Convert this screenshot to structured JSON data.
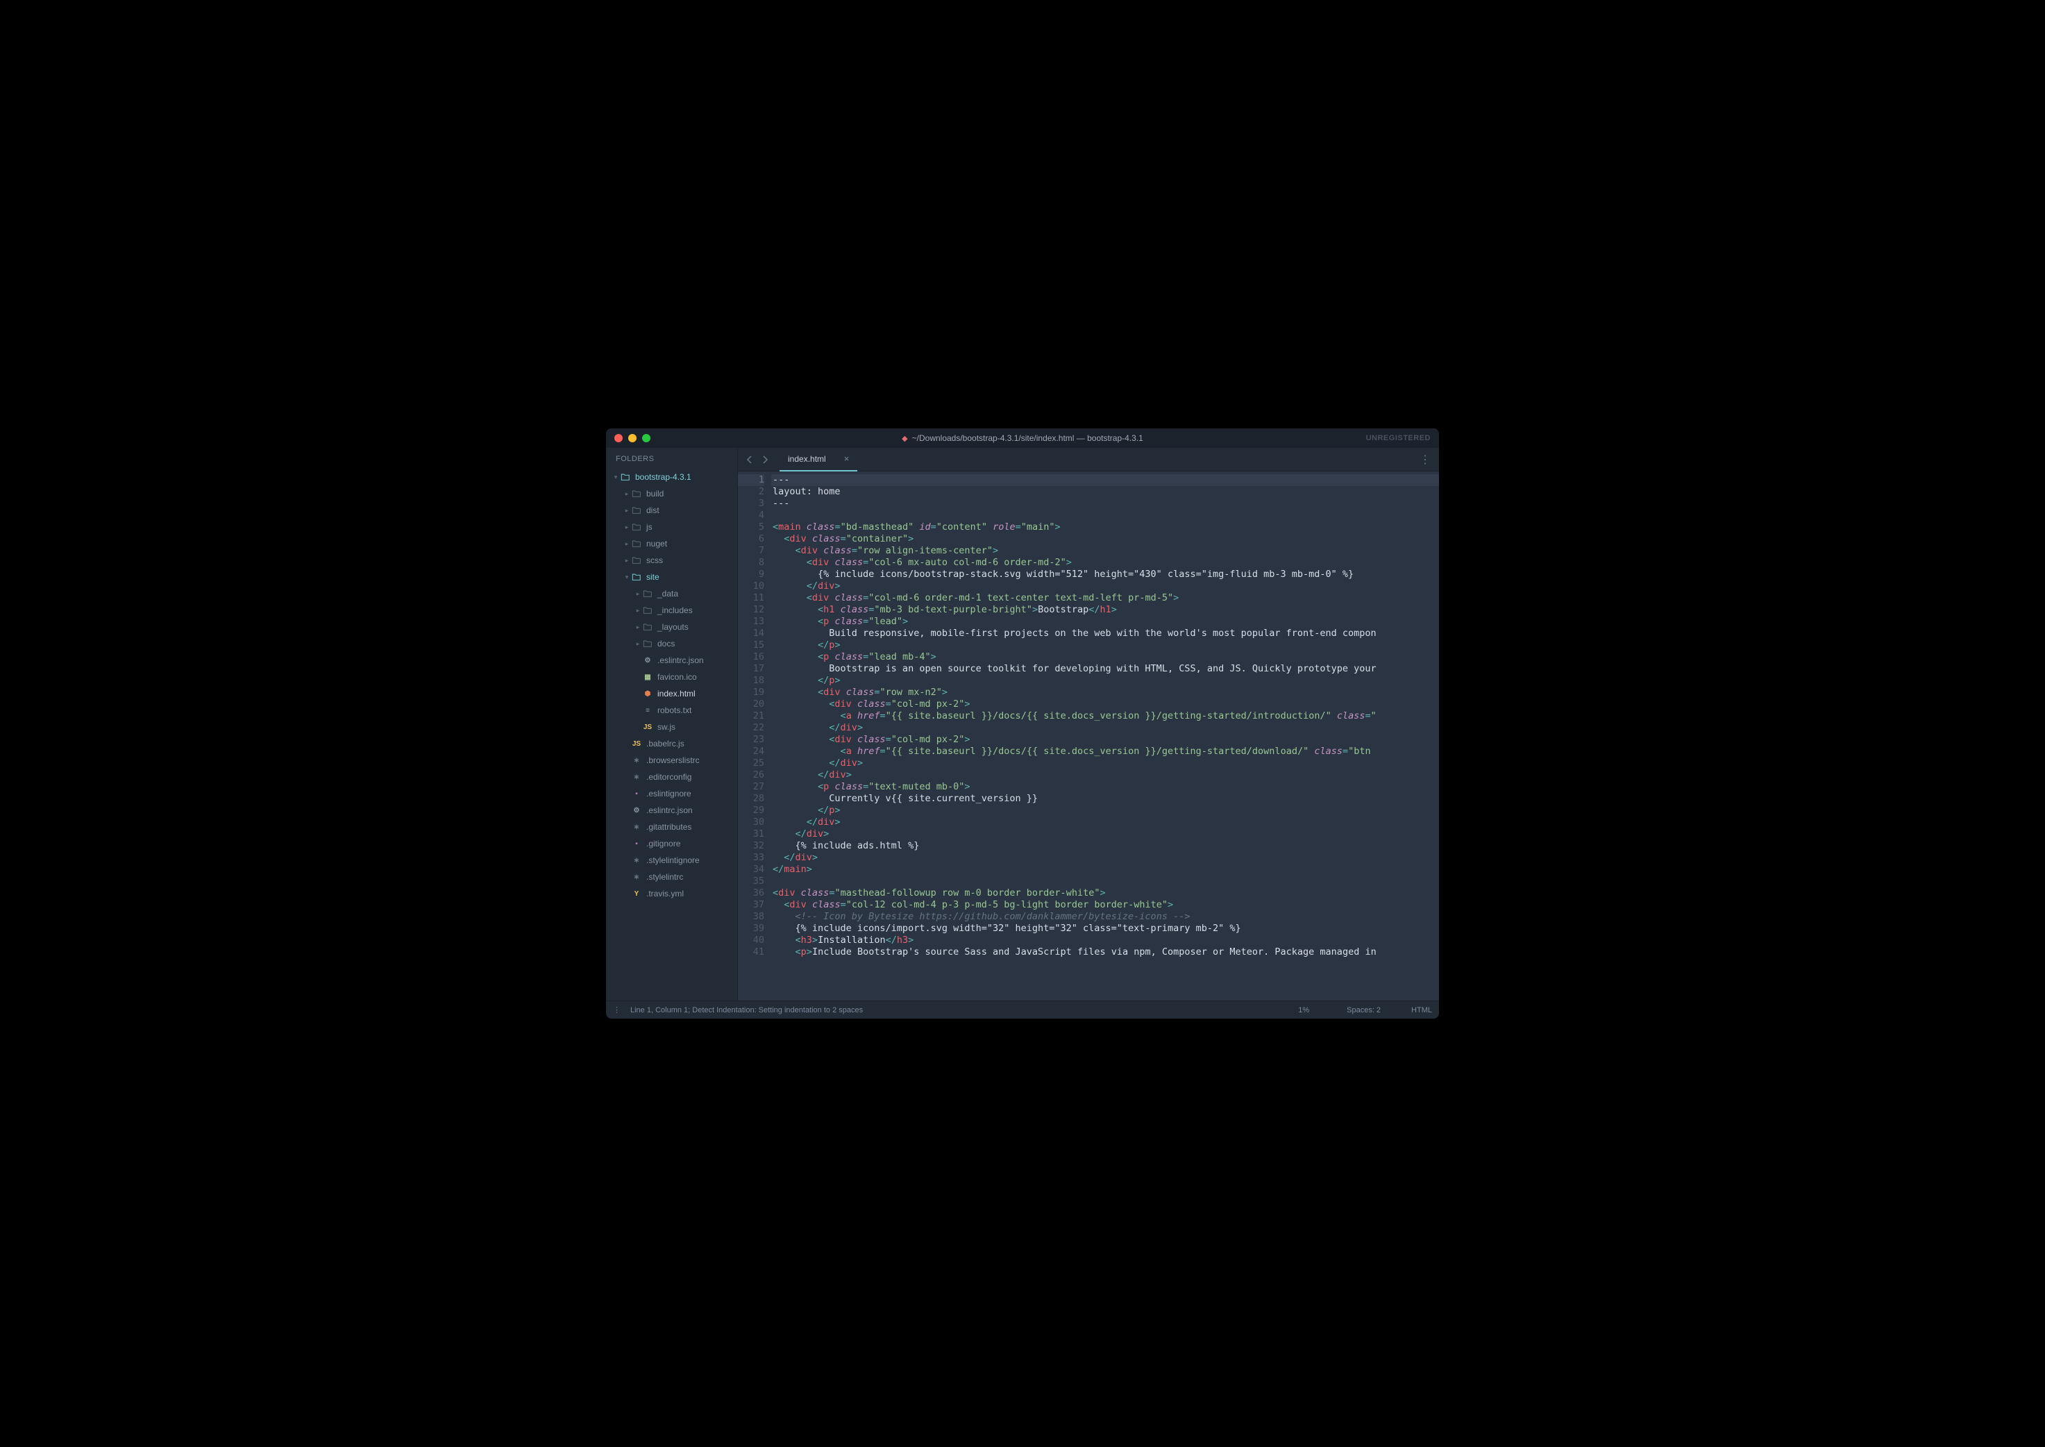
{
  "titlebar": {
    "path": "~/Downloads/bootstrap-4.3.1/site/index.html — bootstrap-4.3.1",
    "unregistered": "UNREGISTERED"
  },
  "sidebar": {
    "header": "FOLDERS",
    "tree": [
      {
        "label": "bootstrap-4.3.1",
        "kind": "folder-open",
        "depth": 0
      },
      {
        "label": "build",
        "kind": "folder",
        "depth": 1
      },
      {
        "label": "dist",
        "kind": "folder",
        "depth": 1
      },
      {
        "label": "js",
        "kind": "folder",
        "depth": 1
      },
      {
        "label": "nuget",
        "kind": "folder",
        "depth": 1
      },
      {
        "label": "scss",
        "kind": "folder",
        "depth": 1
      },
      {
        "label": "site",
        "kind": "folder-open",
        "depth": 1
      },
      {
        "label": "_data",
        "kind": "folder",
        "depth": 2
      },
      {
        "label": "_includes",
        "kind": "folder",
        "depth": 2
      },
      {
        "label": "_layouts",
        "kind": "folder",
        "depth": 2
      },
      {
        "label": "docs",
        "kind": "folder",
        "depth": 2
      },
      {
        "label": ".eslintrc.json",
        "kind": "file",
        "depth": 2,
        "icon": "gear"
      },
      {
        "label": "favicon.ico",
        "kind": "file",
        "depth": 2,
        "icon": "image"
      },
      {
        "label": "index.html",
        "kind": "file",
        "depth": 2,
        "icon": "html",
        "active": true
      },
      {
        "label": "robots.txt",
        "kind": "file",
        "depth": 2,
        "icon": "text"
      },
      {
        "label": "sw.js",
        "kind": "file",
        "depth": 2,
        "icon": "js"
      },
      {
        "label": ".babelrc.js",
        "kind": "file",
        "depth": 1,
        "icon": "js"
      },
      {
        "label": ".browserslistrc",
        "kind": "file",
        "depth": 1,
        "icon": "generic"
      },
      {
        "label": ".editorconfig",
        "kind": "file",
        "depth": 1,
        "icon": "generic"
      },
      {
        "label": ".eslintignore",
        "kind": "file",
        "depth": 1,
        "icon": "ignore"
      },
      {
        "label": ".eslintrc.json",
        "kind": "file",
        "depth": 1,
        "icon": "gear"
      },
      {
        "label": ".gitattributes",
        "kind": "file",
        "depth": 1,
        "icon": "generic"
      },
      {
        "label": ".gitignore",
        "kind": "file",
        "depth": 1,
        "icon": "ignore"
      },
      {
        "label": ".stylelintignore",
        "kind": "file",
        "depth": 1,
        "icon": "generic"
      },
      {
        "label": ".stylelintrc",
        "kind": "file",
        "depth": 1,
        "icon": "generic"
      },
      {
        "label": ".travis.yml",
        "kind": "file",
        "depth": 1,
        "icon": "yaml"
      }
    ]
  },
  "tab": {
    "label": "index.html"
  },
  "code_lines": [
    [
      [
        "pl",
        "---"
      ]
    ],
    [
      [
        "pl",
        "layout: home"
      ]
    ],
    [
      [
        "pl",
        "---"
      ]
    ],
    [],
    [
      [
        "p",
        "<"
      ],
      [
        "t",
        "main"
      ],
      [
        "pl",
        " "
      ],
      [
        "a it",
        "class"
      ],
      [
        "p",
        "="
      ],
      [
        "s",
        "\"bd-masthead\""
      ],
      [
        "pl",
        " "
      ],
      [
        "a it",
        "id"
      ],
      [
        "p",
        "="
      ],
      [
        "s",
        "\"content\""
      ],
      [
        "pl",
        " "
      ],
      [
        "a it",
        "role"
      ],
      [
        "p",
        "="
      ],
      [
        "s",
        "\"main\""
      ],
      [
        "p",
        ">"
      ]
    ],
    [
      [
        "pl",
        "  "
      ],
      [
        "p",
        "<"
      ],
      [
        "t",
        "div"
      ],
      [
        "pl",
        " "
      ],
      [
        "a it",
        "class"
      ],
      [
        "p",
        "="
      ],
      [
        "s",
        "\"container\""
      ],
      [
        "p",
        ">"
      ]
    ],
    [
      [
        "pl",
        "    "
      ],
      [
        "p",
        "<"
      ],
      [
        "t",
        "div"
      ],
      [
        "pl",
        " "
      ],
      [
        "a it",
        "class"
      ],
      [
        "p",
        "="
      ],
      [
        "s",
        "\"row align-items-center\""
      ],
      [
        "p",
        ">"
      ]
    ],
    [
      [
        "pl",
        "      "
      ],
      [
        "p",
        "<"
      ],
      [
        "t",
        "div"
      ],
      [
        "pl",
        " "
      ],
      [
        "a it",
        "class"
      ],
      [
        "p",
        "="
      ],
      [
        "s",
        "\"col-6 mx-auto col-md-6 order-md-2\""
      ],
      [
        "p",
        ">"
      ]
    ],
    [
      [
        "pl",
        "        {% include icons/bootstrap-stack.svg width=\"512\" height=\"430\" class=\"img-fluid mb-3 mb-md-0\" %}"
      ]
    ],
    [
      [
        "pl",
        "      "
      ],
      [
        "p",
        "</"
      ],
      [
        "t",
        "div"
      ],
      [
        "p",
        ">"
      ]
    ],
    [
      [
        "pl",
        "      "
      ],
      [
        "p",
        "<"
      ],
      [
        "t",
        "div"
      ],
      [
        "pl",
        " "
      ],
      [
        "a it",
        "class"
      ],
      [
        "p",
        "="
      ],
      [
        "s",
        "\"col-md-6 order-md-1 text-center text-md-left pr-md-5\""
      ],
      [
        "p",
        ">"
      ]
    ],
    [
      [
        "pl",
        "        "
      ],
      [
        "p",
        "<"
      ],
      [
        "t",
        "h1"
      ],
      [
        "pl",
        " "
      ],
      [
        "a it",
        "class"
      ],
      [
        "p",
        "="
      ],
      [
        "s",
        "\"mb-3 bd-text-purple-bright\""
      ],
      [
        "p",
        ">"
      ],
      [
        "pl",
        "Bootstrap"
      ],
      [
        "p",
        "</"
      ],
      [
        "t",
        "h1"
      ],
      [
        "p",
        ">"
      ]
    ],
    [
      [
        "pl",
        "        "
      ],
      [
        "p",
        "<"
      ],
      [
        "t",
        "p"
      ],
      [
        "pl",
        " "
      ],
      [
        "a it",
        "class"
      ],
      [
        "p",
        "="
      ],
      [
        "s",
        "\"lead\""
      ],
      [
        "p",
        ">"
      ]
    ],
    [
      [
        "pl",
        "          Build responsive, mobile-first projects on the web with the world's most popular front-end compon"
      ]
    ],
    [
      [
        "pl",
        "        "
      ],
      [
        "p",
        "</"
      ],
      [
        "t",
        "p"
      ],
      [
        "p",
        ">"
      ]
    ],
    [
      [
        "pl",
        "        "
      ],
      [
        "p",
        "<"
      ],
      [
        "t",
        "p"
      ],
      [
        "pl",
        " "
      ],
      [
        "a it",
        "class"
      ],
      [
        "p",
        "="
      ],
      [
        "s",
        "\"lead mb-4\""
      ],
      [
        "p",
        ">"
      ]
    ],
    [
      [
        "pl",
        "          Bootstrap is an open source toolkit for developing with HTML, CSS, and JS. Quickly prototype your"
      ]
    ],
    [
      [
        "pl",
        "        "
      ],
      [
        "p",
        "</"
      ],
      [
        "t",
        "p"
      ],
      [
        "p",
        ">"
      ]
    ],
    [
      [
        "pl",
        "        "
      ],
      [
        "p",
        "<"
      ],
      [
        "t",
        "div"
      ],
      [
        "pl",
        " "
      ],
      [
        "a it",
        "class"
      ],
      [
        "p",
        "="
      ],
      [
        "s",
        "\"row mx-n2\""
      ],
      [
        "p",
        ">"
      ]
    ],
    [
      [
        "pl",
        "          "
      ],
      [
        "p",
        "<"
      ],
      [
        "t",
        "div"
      ],
      [
        "pl",
        " "
      ],
      [
        "a it",
        "class"
      ],
      [
        "p",
        "="
      ],
      [
        "s",
        "\"col-md px-2\""
      ],
      [
        "p",
        ">"
      ]
    ],
    [
      [
        "pl",
        "            "
      ],
      [
        "p",
        "<"
      ],
      [
        "t",
        "a"
      ],
      [
        "pl",
        " "
      ],
      [
        "a it",
        "href"
      ],
      [
        "p",
        "="
      ],
      [
        "s",
        "\"{{ site.baseurl }}/docs/{{ site.docs_version }}/getting-started/introduction/\""
      ],
      [
        "pl",
        " "
      ],
      [
        "a it",
        "class"
      ],
      [
        "p",
        "="
      ],
      [
        "s",
        "\""
      ]
    ],
    [
      [
        "pl",
        "          "
      ],
      [
        "p",
        "</"
      ],
      [
        "t",
        "div"
      ],
      [
        "p",
        ">"
      ]
    ],
    [
      [
        "pl",
        "          "
      ],
      [
        "p",
        "<"
      ],
      [
        "t",
        "div"
      ],
      [
        "pl",
        " "
      ],
      [
        "a it",
        "class"
      ],
      [
        "p",
        "="
      ],
      [
        "s",
        "\"col-md px-2\""
      ],
      [
        "p",
        ">"
      ]
    ],
    [
      [
        "pl",
        "            "
      ],
      [
        "p",
        "<"
      ],
      [
        "t",
        "a"
      ],
      [
        "pl",
        " "
      ],
      [
        "a it",
        "href"
      ],
      [
        "p",
        "="
      ],
      [
        "s",
        "\"{{ site.baseurl }}/docs/{{ site.docs_version }}/getting-started/download/\""
      ],
      [
        "pl",
        " "
      ],
      [
        "a it",
        "class"
      ],
      [
        "p",
        "="
      ],
      [
        "s",
        "\"btn"
      ]
    ],
    [
      [
        "pl",
        "          "
      ],
      [
        "p",
        "</"
      ],
      [
        "t",
        "div"
      ],
      [
        "p",
        ">"
      ]
    ],
    [
      [
        "pl",
        "        "
      ],
      [
        "p",
        "</"
      ],
      [
        "t",
        "div"
      ],
      [
        "p",
        ">"
      ]
    ],
    [
      [
        "pl",
        "        "
      ],
      [
        "p",
        "<"
      ],
      [
        "t",
        "p"
      ],
      [
        "pl",
        " "
      ],
      [
        "a it",
        "class"
      ],
      [
        "p",
        "="
      ],
      [
        "s",
        "\"text-muted mb-0\""
      ],
      [
        "p",
        ">"
      ]
    ],
    [
      [
        "pl",
        "          Currently v{{ site.current_version }}"
      ]
    ],
    [
      [
        "pl",
        "        "
      ],
      [
        "p",
        "</"
      ],
      [
        "t",
        "p"
      ],
      [
        "p",
        ">"
      ]
    ],
    [
      [
        "pl",
        "      "
      ],
      [
        "p",
        "</"
      ],
      [
        "t",
        "div"
      ],
      [
        "p",
        ">"
      ]
    ],
    [
      [
        "pl",
        "    "
      ],
      [
        "p",
        "</"
      ],
      [
        "t",
        "div"
      ],
      [
        "p",
        ">"
      ]
    ],
    [
      [
        "pl",
        "    {% include ads.html %}"
      ]
    ],
    [
      [
        "pl",
        "  "
      ],
      [
        "p",
        "</"
      ],
      [
        "t",
        "div"
      ],
      [
        "p",
        ">"
      ]
    ],
    [
      [
        "p",
        "</"
      ],
      [
        "t",
        "main"
      ],
      [
        "p",
        ">"
      ]
    ],
    [],
    [
      [
        "p",
        "<"
      ],
      [
        "t",
        "div"
      ],
      [
        "pl",
        " "
      ],
      [
        "a it",
        "class"
      ],
      [
        "p",
        "="
      ],
      [
        "s",
        "\"masthead-followup row m-0 border border-white\""
      ],
      [
        "p",
        ">"
      ]
    ],
    [
      [
        "pl",
        "  "
      ],
      [
        "p",
        "<"
      ],
      [
        "t",
        "div"
      ],
      [
        "pl",
        " "
      ],
      [
        "a it",
        "class"
      ],
      [
        "p",
        "="
      ],
      [
        "s",
        "\"col-12 col-md-4 p-3 p-md-5 bg-light border border-white\""
      ],
      [
        "p",
        ">"
      ]
    ],
    [
      [
        "pl",
        "    "
      ],
      [
        "cm",
        "<!-- Icon by Bytesize https://github.com/danklammer/bytesize-icons -->"
      ]
    ],
    [
      [
        "pl",
        "    {% include icons/import.svg width=\"32\" height=\"32\" class=\"text-primary mb-2\" %}"
      ]
    ],
    [
      [
        "pl",
        "    "
      ],
      [
        "p",
        "<"
      ],
      [
        "t",
        "h3"
      ],
      [
        "p",
        ">"
      ],
      [
        "pl",
        "Installation"
      ],
      [
        "p",
        "</"
      ],
      [
        "t",
        "h3"
      ],
      [
        "p",
        ">"
      ]
    ],
    [
      [
        "pl",
        "    "
      ],
      [
        "p",
        "<"
      ],
      [
        "t",
        "p"
      ],
      [
        "p",
        ">"
      ],
      [
        "pl",
        "Include Bootstrap's source Sass and JavaScript files via npm, Composer or Meteor. Package managed in"
      ]
    ]
  ],
  "status": {
    "left": "Line 1, Column 1; Detect Indentation: Setting indentation to 2 spaces",
    "percent": "1%",
    "spaces": "Spaces: 2",
    "syntax": "HTML"
  }
}
